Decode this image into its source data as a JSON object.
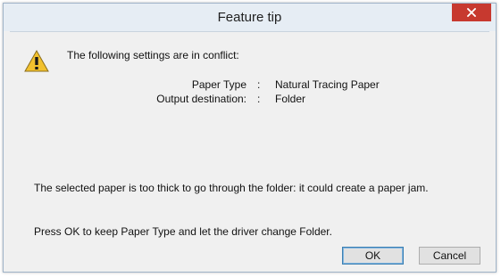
{
  "window": {
    "title": "Feature tip",
    "close_glyph": "✕",
    "accent": "#c7392f"
  },
  "dialog": {
    "icon": "warning-icon",
    "heading": "The following settings are in conflict:",
    "settings": [
      {
        "label": "Paper Type",
        "separator": ":",
        "value": "Natural Tracing Paper"
      },
      {
        "label": "Output destination:",
        "separator": ":",
        "value": "Folder"
      }
    ],
    "message": "The selected paper is too thick to go through the folder: it could create a paper jam.",
    "instruction": "Press OK to keep Paper Type and let the driver change Folder."
  },
  "buttons": {
    "ok_label": "OK",
    "cancel_label": "Cancel"
  }
}
